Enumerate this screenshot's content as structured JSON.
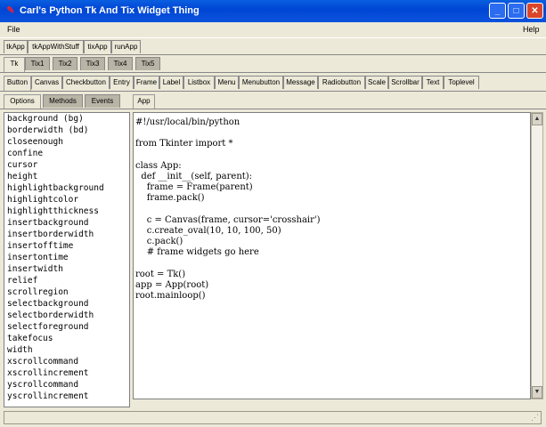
{
  "window": {
    "title": "Carl's Python Tk And Tix Widget Thing",
    "minimize": "_",
    "maximize": "□",
    "close": "✕",
    "icon": "feather-icon"
  },
  "menubar": {
    "file": "File",
    "help": "Help"
  },
  "app_tabs": [
    "tkApp",
    "tkAppWithStuff",
    "tixApp",
    "runApp"
  ],
  "lib_tabs": [
    "Tk",
    "Tix1",
    "Tix2",
    "Tix3",
    "Tix4",
    "Tix5"
  ],
  "widget_tabs": [
    "Button",
    "Canvas",
    "Checkbutton",
    "Entry",
    "Frame",
    "Label",
    "Listbox",
    "Menu",
    "Menubutton",
    "Message",
    "Radiobutton",
    "Scale",
    "Scrollbar",
    "Text",
    "Toplevel"
  ],
  "sub_tabs": [
    "Options",
    "Methods",
    "Events"
  ],
  "code_tab": "App",
  "options": [
    "background (bg)",
    "borderwidth (bd)",
    "closeenough",
    "confine",
    "cursor",
    "height",
    "highlightbackground",
    "highlightcolor",
    "highlightthickness",
    "insertbackground",
    "insertborderwidth",
    "insertofftime",
    "insertontime",
    "insertwidth",
    "relief",
    "scrollregion",
    "selectbackground",
    "selectborderwidth",
    "selectforeground",
    "takefocus",
    "width",
    "xscrollcommand",
    "xscrollincrement",
    "yscrollcommand",
    "yscrollincrement"
  ],
  "code": [
    "#!/usr/local/bin/python",
    "",
    "from Tkinter import *",
    "",
    "class App:",
    "  def __init__(self, parent):",
    "    frame = Frame(parent)",
    "    frame.pack()",
    "",
    "    c = Canvas(frame, cursor='crosshair')",
    "    c.create_oval(10, 10, 100, 50)",
    "    c.pack()",
    "    # frame widgets go here",
    "",
    "root = Tk()",
    "app = App(root)",
    "root.mainloop()"
  ]
}
